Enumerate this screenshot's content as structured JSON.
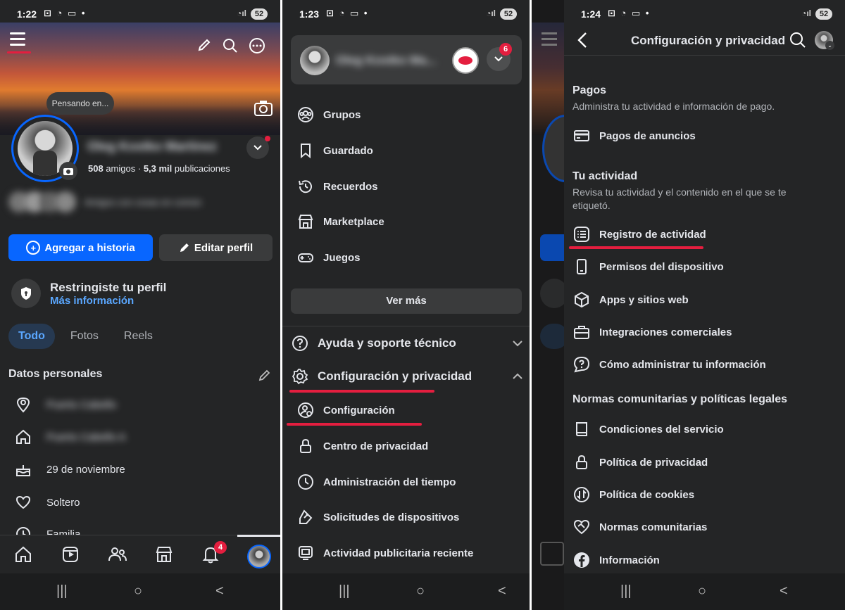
{
  "panel1": {
    "status_time": "1:22",
    "battery": "52",
    "thought_bubble": "Pensando en...",
    "profile_name": "Oleg Kostko Martinez",
    "friends_count": "508",
    "friends_label": "amigos",
    "posts_count": "5,3 mil",
    "posts_label": "publicaciones",
    "mutual_friends_text": "Amigos con cosas en común",
    "add_story_label": "Agregar a historia",
    "edit_profile_label": "Editar perfil",
    "restricted_title": "Restringiste tu perfil",
    "restricted_link": "Más información",
    "tabs": [
      {
        "label": "Todo",
        "active": true
      },
      {
        "label": "Fotos",
        "active": false
      },
      {
        "label": "Reels",
        "active": false
      }
    ],
    "personal_title": "Datos personales",
    "personal_items": [
      {
        "icon": "location-pin-icon",
        "text": "Puerto Cabello",
        "blurred": true
      },
      {
        "icon": "home-icon",
        "text": "Puerto Cabello A",
        "blurred": true
      },
      {
        "icon": "birthday-cake-icon",
        "text": "29 de noviembre",
        "blurred": false
      },
      {
        "icon": "heart-icon",
        "text": "Soltero",
        "blurred": false
      },
      {
        "icon": "family-icon",
        "text": "Familia",
        "blurred": false
      }
    ],
    "notifications_badge": "4"
  },
  "panel2": {
    "status_time": "1:23",
    "battery": "52",
    "account_name": "Oleg Kostko Ma...",
    "account_badge": "6",
    "menu_items": [
      {
        "icon": "groups-icon",
        "label": "Grupos"
      },
      {
        "icon": "bookmark-icon",
        "label": "Guardado"
      },
      {
        "icon": "memories-icon",
        "label": "Recuerdos"
      },
      {
        "icon": "marketplace-icon",
        "label": "Marketplace"
      },
      {
        "icon": "gamepad-icon",
        "label": "Juegos"
      }
    ],
    "see_more_label": "Ver más",
    "help_label": "Ayuda y soporte técnico",
    "settings_privacy_label": "Configuración y privacidad",
    "sub_items": [
      {
        "icon": "settings-user-icon",
        "label": "Configuración"
      },
      {
        "icon": "lock-icon",
        "label": "Centro de privacidad"
      },
      {
        "icon": "clock-icon",
        "label": "Administración del tiempo"
      },
      {
        "icon": "device-request-icon",
        "label": "Solicitudes de dispositivos"
      },
      {
        "icon": "ad-activity-icon",
        "label": "Actividad publicitaria reciente"
      }
    ]
  },
  "panel3": {
    "status_time": "1:24",
    "battery": "52",
    "header_title": "Configuración y privacidad",
    "payments_title": "Pagos",
    "payments_sub": "Administra tu actividad e información de pago.",
    "payments_items": [
      {
        "icon": "credit-card-icon",
        "label": "Pagos de anuncios"
      }
    ],
    "activity_title": "Tu actividad",
    "activity_sub": "Revisa tu actividad y el contenido en el que se te etiquetó.",
    "activity_items": [
      {
        "icon": "activity-log-icon",
        "label": "Registro de actividad"
      },
      {
        "icon": "phone-icon",
        "label": "Permisos del dispositivo"
      },
      {
        "icon": "cube-icon",
        "label": "Apps y sitios web"
      },
      {
        "icon": "briefcase-icon",
        "label": "Integraciones comerciales"
      },
      {
        "icon": "help-chat-icon",
        "label": "Cómo administrar tu información"
      }
    ],
    "legal_title": "Normas comunitarias y políticas legales",
    "legal_items": [
      {
        "icon": "book-icon",
        "label": "Condiciones del servicio"
      },
      {
        "icon": "lock-icon",
        "label": "Política de privacidad"
      },
      {
        "icon": "cookies-icon",
        "label": "Política de cookies"
      },
      {
        "icon": "handshake-heart-icon",
        "label": "Normas comunitarias"
      },
      {
        "icon": "facebook-icon",
        "label": "Información"
      }
    ]
  },
  "colors": {
    "bg": "#242526",
    "accent_blue": "#0866ff",
    "link_blue": "#5aa7ff",
    "red": "#e41e3f",
    "button_grey": "#3a3b3c"
  }
}
